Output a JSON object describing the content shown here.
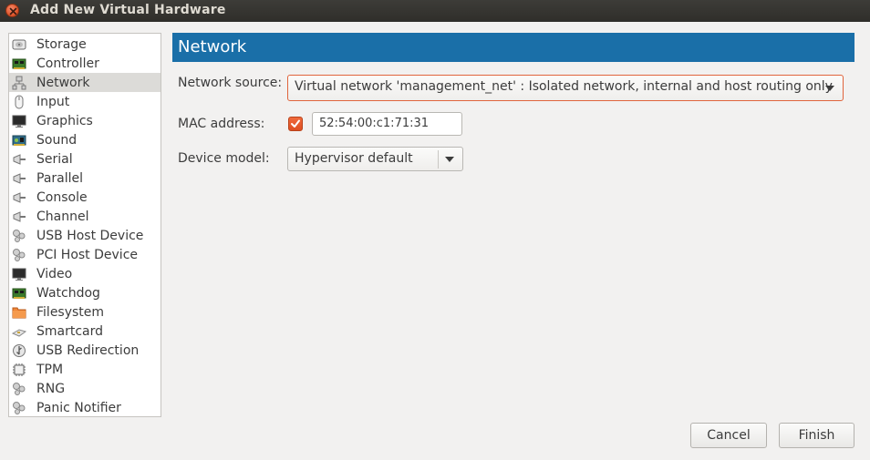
{
  "window": {
    "title": "Add New Virtual Hardware"
  },
  "sidebar": {
    "items": [
      {
        "label": "Storage",
        "icon": "storage-icon"
      },
      {
        "label": "Controller",
        "icon": "controller-icon"
      },
      {
        "label": "Network",
        "icon": "network-icon",
        "selected": true
      },
      {
        "label": "Input",
        "icon": "mouse-icon"
      },
      {
        "label": "Graphics",
        "icon": "monitor-icon"
      },
      {
        "label": "Sound",
        "icon": "sound-card-icon"
      },
      {
        "label": "Serial",
        "icon": "serial-port-icon"
      },
      {
        "label": "Parallel",
        "icon": "parallel-port-icon"
      },
      {
        "label": "Console",
        "icon": "console-port-icon"
      },
      {
        "label": "Channel",
        "icon": "channel-port-icon"
      },
      {
        "label": "USB Host Device",
        "icon": "usb-host-icon"
      },
      {
        "label": "PCI Host Device",
        "icon": "pci-host-icon"
      },
      {
        "label": "Video",
        "icon": "monitor-icon"
      },
      {
        "label": "Watchdog",
        "icon": "watchdog-icon"
      },
      {
        "label": "Filesystem",
        "icon": "folder-icon"
      },
      {
        "label": "Smartcard",
        "icon": "smartcard-icon"
      },
      {
        "label": "USB Redirection",
        "icon": "usb-redirection-icon"
      },
      {
        "label": "TPM",
        "icon": "chip-icon"
      },
      {
        "label": "RNG",
        "icon": "rng-icon"
      },
      {
        "label": "Panic Notifier",
        "icon": "panic-notifier-icon"
      }
    ]
  },
  "panel": {
    "title": "Network",
    "network_source_label": "Network source:",
    "network_source_value": "Virtual network 'management_net' : Isolated network, internal and host routing only",
    "mac_label": "MAC address:",
    "mac_checked": true,
    "mac_value": "52:54:00:c1:71:31",
    "device_model_label": "Device model:",
    "device_model_value": "Hypervisor default"
  },
  "buttons": {
    "cancel": "Cancel",
    "finish": "Finish"
  },
  "colors": {
    "header_bg": "#1a6fa8",
    "accent_orange": "#e0582e",
    "selected_row": "#dcdbd8",
    "titlebar": "#3d3c38"
  }
}
